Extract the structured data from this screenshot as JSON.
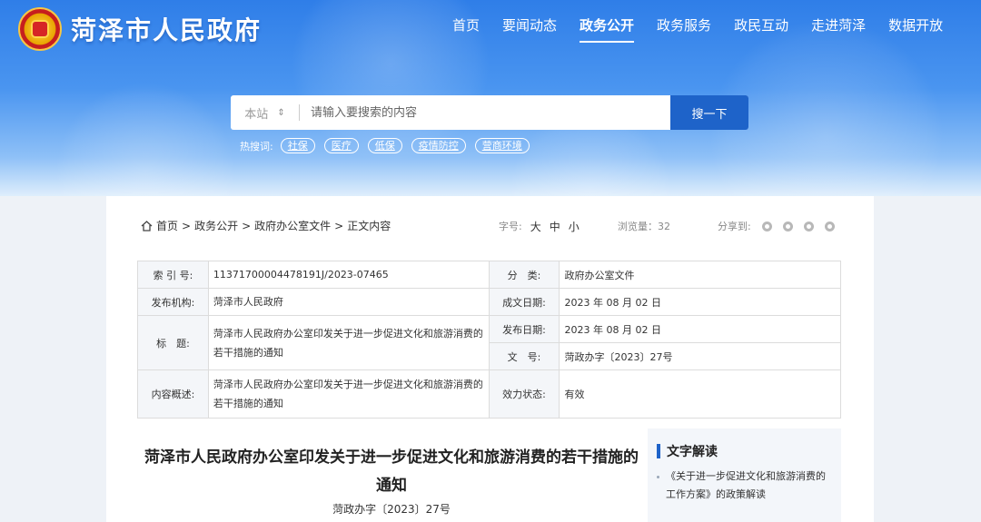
{
  "header": {
    "site_title": "菏泽市人民政府",
    "nav": [
      "首页",
      "要闻动态",
      "政务公开",
      "政务服务",
      "政民互动",
      "走进菏泽",
      "数据开放"
    ],
    "active_nav": "政务公开"
  },
  "search": {
    "scope": "本站",
    "placeholder": "请输入要搜索的内容",
    "button": "搜一下",
    "hot_label": "热搜词:",
    "hot_tags": [
      "社保",
      "医疗",
      "低保",
      "疫情防控",
      "营商环境"
    ]
  },
  "breadcrumb": [
    "首页",
    "政务公开",
    "政府办公室文件",
    "正文内容"
  ],
  "toolbar": {
    "font_label": "字号:",
    "font_big": "大",
    "font_mid": "中",
    "font_small": "小",
    "views": "浏览量：32",
    "share_label": "分享到:"
  },
  "meta": {
    "index_label": "索 引 号:",
    "index_value": "11371700004478191J/2023-07465",
    "category_label": "分　类:",
    "category_value": "政府办公室文件",
    "publisher_label": "发布机构:",
    "publisher_value": "菏泽市人民政府",
    "created_label": "成文日期:",
    "created_value": "2023 年 08 月 02 日",
    "title_label": "标　题:",
    "title_value": "菏泽市人民政府办公室印发关于进一步促进文化和旅游消费的若干措施的通知",
    "published_label": "发布日期:",
    "published_value": "2023 年 08 月 02 日",
    "docno_label": "文　号:",
    "docno_value": "菏政办字〔2023〕27号",
    "summary_label": "内容概述:",
    "summary_value": "菏泽市人民政府办公室印发关于进一步促进文化和旅游消费的若干措施的通知",
    "status_label": "效力状态:",
    "status_value": "有效"
  },
  "document": {
    "title": "菏泽市人民政府办公室印发关于进一步促进文化和旅游消费的若干措施的通知",
    "number": "菏政办字〔2023〕27号"
  },
  "sidebar": {
    "heading": "文字解读",
    "item": "《关于进一步促进文化和旅游消费的工作方案》的政策解读"
  },
  "colors": {
    "primary": "#1e63c9",
    "banner": "#3d8bef"
  }
}
